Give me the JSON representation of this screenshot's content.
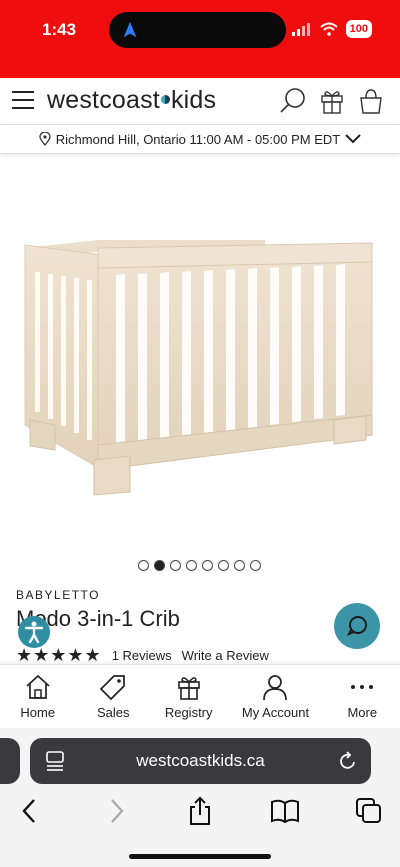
{
  "status_bar": {
    "time": "1:43",
    "battery": "100",
    "bg_color": "#f00d0d"
  },
  "header": {
    "logo_left": "westcoast",
    "logo_right": "kids",
    "location": "Richmond Hill, Ontario 11:00 AM - 05:00 PM EDT"
  },
  "product": {
    "image_icon": "crib-image",
    "carousel": {
      "count": 8,
      "active_index": 1
    },
    "brand": "BABYLETTO",
    "title": "Modo 3-in-1 Crib",
    "rating": 5,
    "reviews": "1 Reviews",
    "write_review": "Write a Review"
  },
  "bottom_nav": {
    "home": "Home",
    "sales": "Sales",
    "registry": "Registry",
    "account": "My Account",
    "more": "More"
  },
  "browser": {
    "url": "westcoastkids.ca"
  },
  "colors": {
    "accent": "#3d96a8",
    "status": "#f00d0d"
  }
}
